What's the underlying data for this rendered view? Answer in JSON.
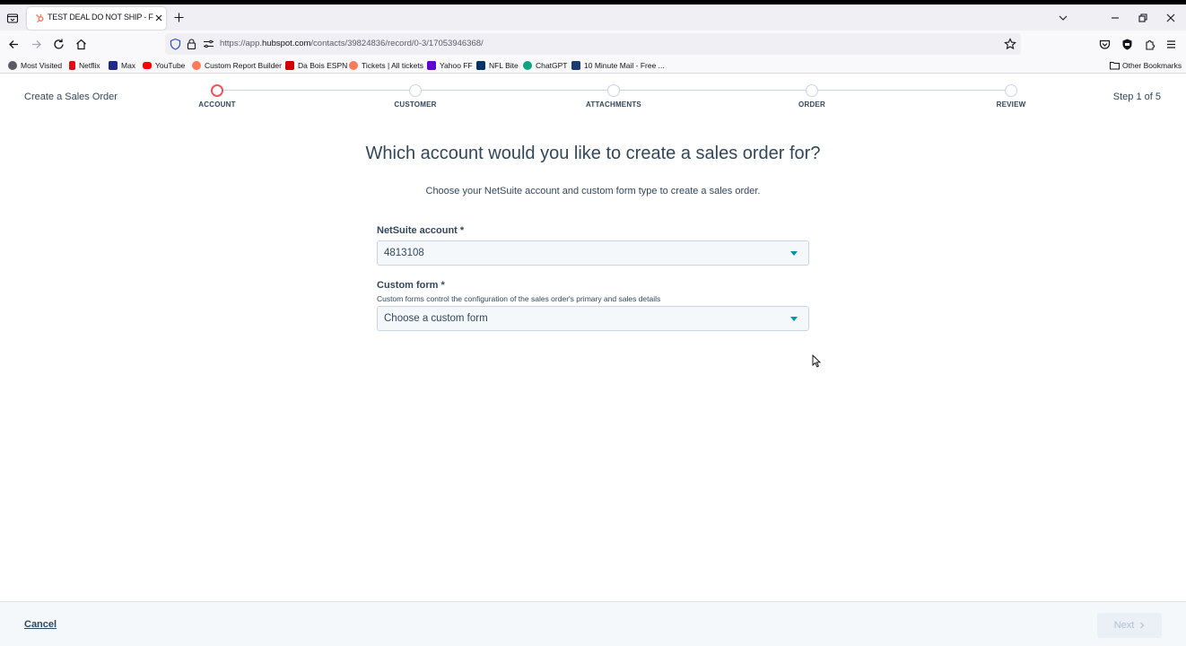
{
  "browser": {
    "tab_title": "TEST DEAL DO NOT SHIP - FOR",
    "url_prefix": "https://app.",
    "url_domain": "hubspot.com",
    "url_path": "/contacts/39824836/record/0-3/17053946368/",
    "bookmarks": [
      {
        "label": "Most Visited",
        "icon": "gear-icon",
        "color": "#5b5b66"
      },
      {
        "label": "Netflix",
        "icon": "netflix-icon",
        "color": "#e50914"
      },
      {
        "label": "Max",
        "icon": "max-icon",
        "color": "#1f2a8c"
      },
      {
        "label": "YouTube",
        "icon": "youtube-icon",
        "color": "#ff0000"
      },
      {
        "label": "Custom Report Builder",
        "icon": "hubspot-icon",
        "color": "#ff7a59"
      },
      {
        "label": "Da Bois ESPN",
        "icon": "espn-icon",
        "color": "#cc0000"
      },
      {
        "label": "Tickets | All tickets",
        "icon": "hubspot-icon",
        "color": "#ff7a59"
      },
      {
        "label": "Yahoo FF",
        "icon": "yahoo-icon",
        "color": "#6001d2"
      },
      {
        "label": "NFL Bite",
        "icon": "nfl-icon",
        "color": "#013369"
      },
      {
        "label": "ChatGPT",
        "icon": "chatgpt-icon",
        "color": "#10a37f"
      },
      {
        "label": "10 Minute Mail - Free ...",
        "icon": "mail-icon",
        "color": "#1d3b73"
      }
    ],
    "other_bookmarks": "Other Bookmarks"
  },
  "app": {
    "title": "Create a Sales Order",
    "step_indicator": "Step 1 of 5",
    "steps": [
      "ACCOUNT",
      "CUSTOMER",
      "ATTACHMENTS",
      "ORDER",
      "REVIEW"
    ],
    "active_step": 0,
    "heading": "Which account would you like to create a sales order for?",
    "subtitle": "Choose your NetSuite account and custom form type to create a sales order.",
    "netsuite_account": {
      "label": "NetSuite account *",
      "value": "4813108"
    },
    "custom_form": {
      "label": "Custom form *",
      "help": "Custom forms control the configuration of the sales order's primary and sales details",
      "placeholder": "Choose a custom form"
    },
    "footer": {
      "cancel": "Cancel",
      "next": "Next"
    }
  },
  "colors": {
    "accent": "#f2545b",
    "text": "#33475b",
    "caret": "#0091ae",
    "disabled": "#b0c1d4"
  }
}
